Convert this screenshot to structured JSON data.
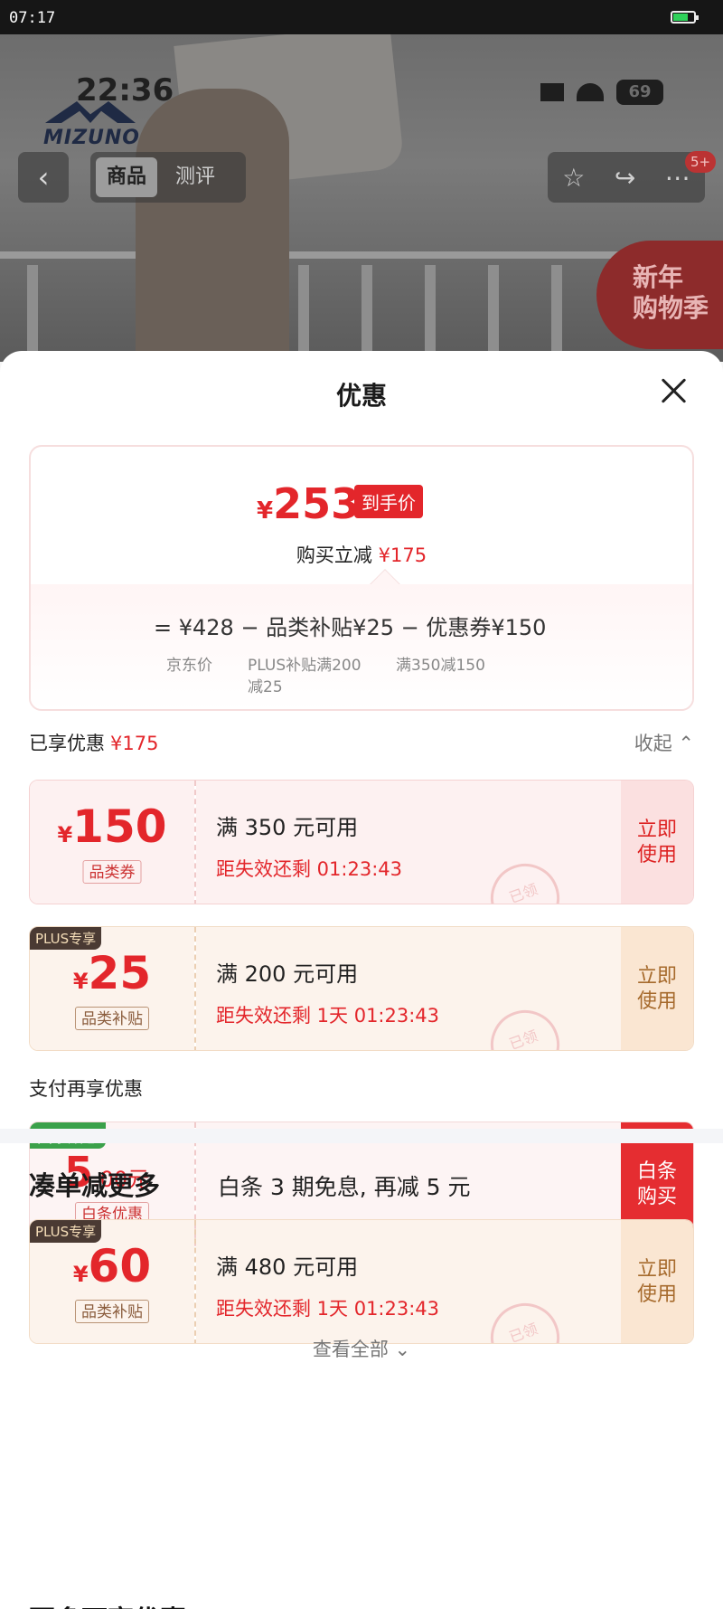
{
  "status": {
    "time": "07:17"
  },
  "hero": {
    "brand": "MIZUNO",
    "overlay_time": "22:36",
    "overlay_battery": "69",
    "back_icon": "chevron-left-icon",
    "tabs": [
      "商品",
      "测评"
    ],
    "badge": "5+",
    "festival": "新年购物季",
    "festival_line1": "新年",
    "festival_line2": "购物季"
  },
  "sheet": {
    "title": "优惠",
    "summary": {
      "yen": "¥",
      "price": "253",
      "price_tag": "到手价",
      "save_text": "购买立减",
      "save_amount": "¥175",
      "formula": "= ¥428 − 品类补贴¥25 − 优惠券¥150",
      "sub_jd": "京东价",
      "sub_plus_1": "PLUS补贴满200",
      "sub_plus_2": "减25",
      "sub_coupon": "满350减150"
    },
    "enjoyed_label": "已享优惠",
    "enjoyed_amount": "¥175",
    "collapse": "收起 ⌃",
    "coupons": [
      {
        "yen": "¥",
        "amount": "150",
        "kind": "品类券",
        "cond": "满 350 元可用",
        "expire": "距失效还剩 01:23:43",
        "action_1": "立即",
        "action_2": "使用",
        "seal": "已领"
      },
      {
        "badge": "PLUS专享",
        "yen": "¥",
        "amount": "25",
        "kind": "品类补贴",
        "cond": "满 200 元可用",
        "expire": "距失效还剩 1天 01:23:43",
        "action_1": "立即",
        "action_2": "使用",
        "seal": "已领"
      }
    ],
    "pay_label": "支付再享优惠",
    "pay": {
      "badge": "国家贴息",
      "amount": "5",
      "decimal": ".00元",
      "kind": "白条优惠",
      "desc": "白条 3 期免息, 再减 5 元",
      "action_1": "白条",
      "action_2": "购买"
    },
    "more_title": "凑单减更多",
    "more_coupon": {
      "badge": "PLUS专享",
      "yen": "¥",
      "amount": "60",
      "kind": "品类补贴",
      "cond": "满 480 元可用",
      "expire": "距失效还剩 1天 01:23:43",
      "action_1": "立即",
      "action_2": "使用",
      "seal": "已领"
    },
    "view_all": "查看全部 ⌄",
    "next_title": "更多可享优惠"
  }
}
